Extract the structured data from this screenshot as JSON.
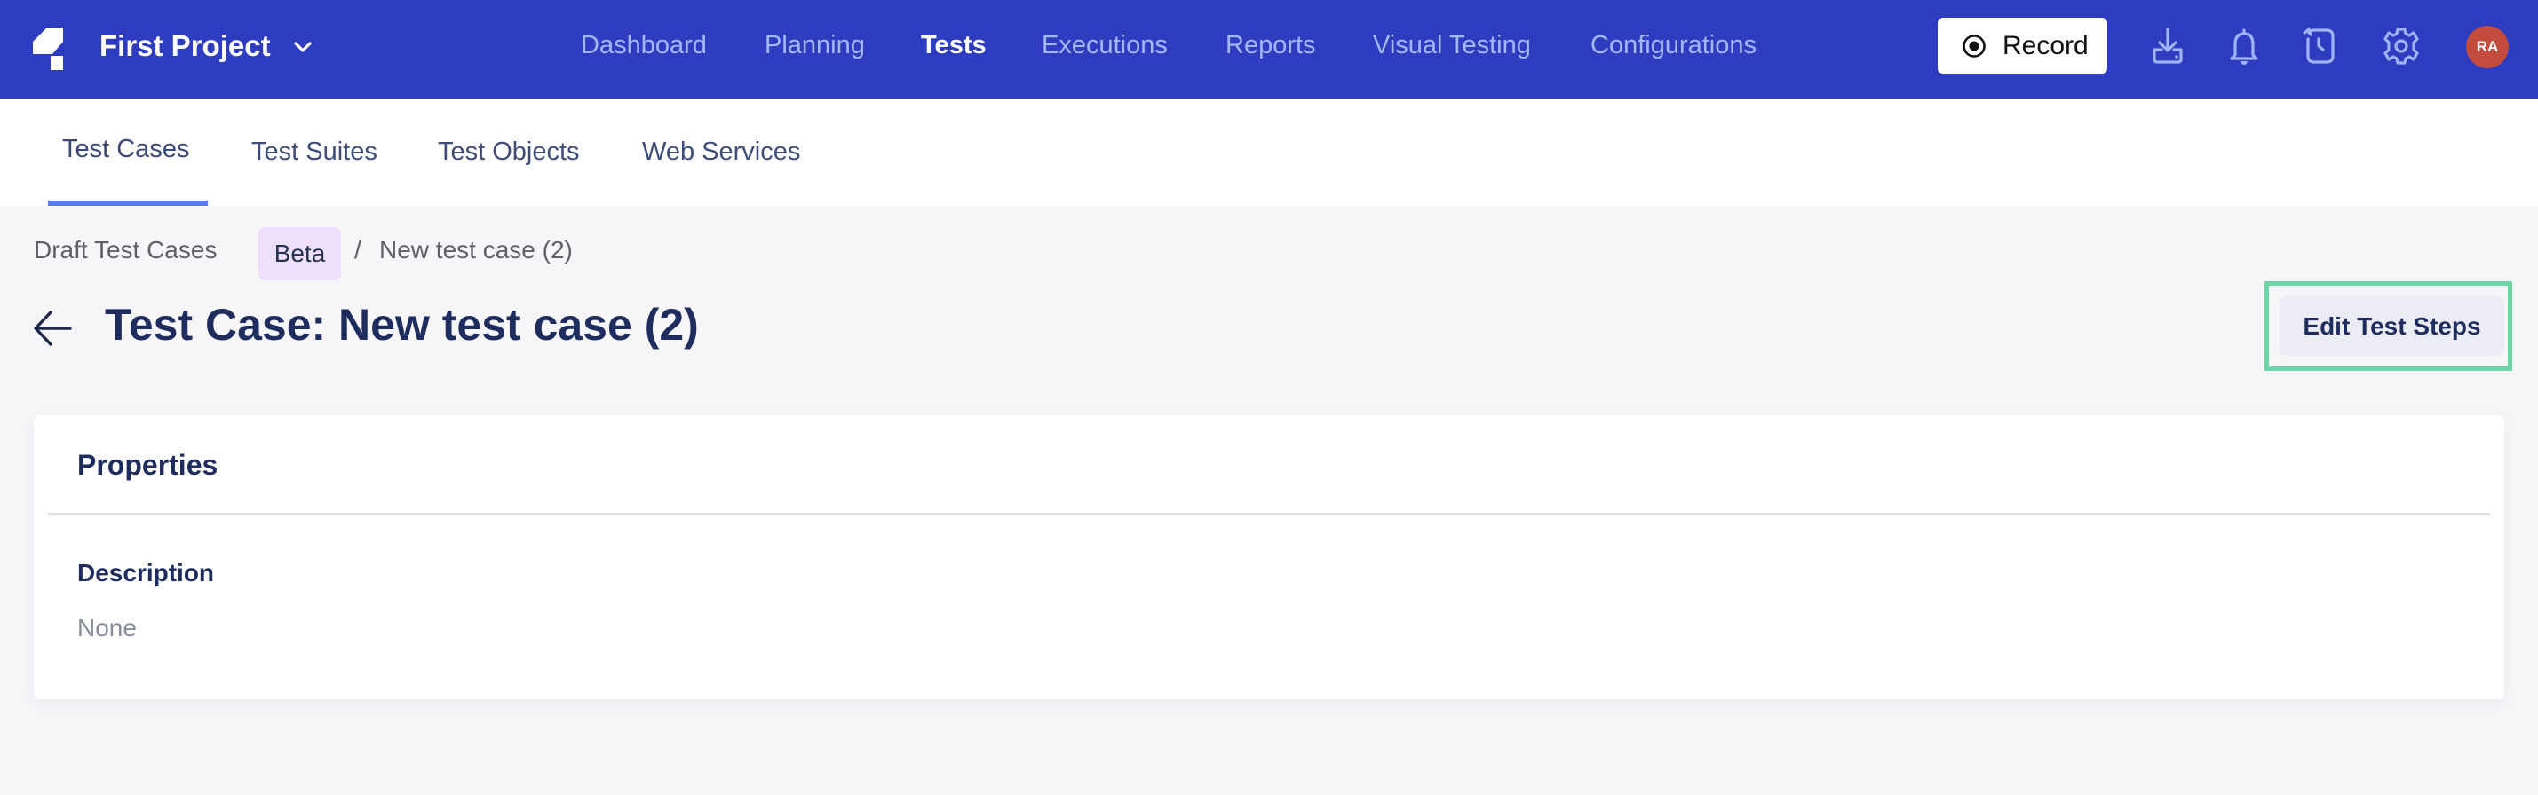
{
  "header": {
    "project_name": "First Project",
    "nav": [
      {
        "label": "Dashboard",
        "active": false
      },
      {
        "label": "Planning",
        "active": false
      },
      {
        "label": "Tests",
        "active": true
      },
      {
        "label": "Executions",
        "active": false
      },
      {
        "label": "Reports",
        "active": false
      },
      {
        "label": "Visual Testing",
        "active": false
      },
      {
        "label": "Configurations",
        "active": false
      }
    ],
    "record_label": "Record",
    "icons": [
      "download-icon",
      "bell-icon",
      "history-icon",
      "gear-icon"
    ],
    "avatar_initials": "RA",
    "colors": {
      "bar": "#2E3DBF",
      "nav_inactive": "#A4B7F5",
      "avatar": "#C44C3E"
    }
  },
  "subnav": {
    "tabs": [
      {
        "label": "Test Cases",
        "active": true
      },
      {
        "label": "Test Suites",
        "active": false
      },
      {
        "label": "Test Objects",
        "active": false
      },
      {
        "label": "Web Services",
        "active": false
      }
    ],
    "accent": "#5B7BEF"
  },
  "breadcrumb": {
    "root": "Draft Test Cases",
    "badge": "Beta",
    "separator": "/",
    "current": "New test case (2)"
  },
  "page": {
    "title": "Test Case: New test case (2)",
    "edit_button_label": "Edit Test Steps",
    "highlight_color": "#6DD6A4"
  },
  "properties": {
    "title": "Properties",
    "fields": [
      {
        "label": "Description",
        "value": "None"
      }
    ]
  }
}
